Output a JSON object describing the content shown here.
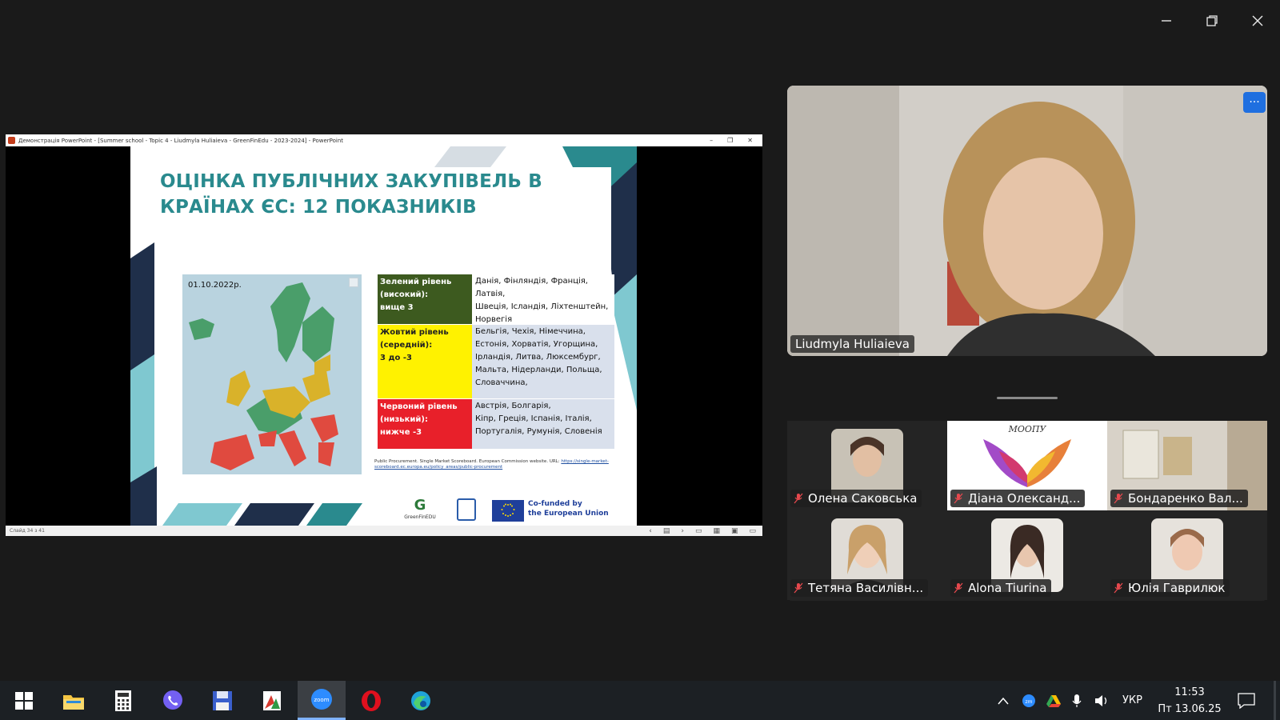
{
  "window": {
    "minimize": "minimize",
    "maximize": "restore",
    "close": "close"
  },
  "share": {
    "pp_title": "Демонстрація PowerPoint - [Summer school - Topic 4 - Liudmyla Huliaieva - GreenFinEdu - 2023-2024] - PowerPoint",
    "status": "Слайд 34 з 41",
    "slide": {
      "title": "ОЦІНКА ПУБЛІЧНИХ ЗАКУПІВЕЛЬ В КРАЇНАХ ЄС: 12 ПОКАЗНИКІВ",
      "map_date": "01.10.2022р.",
      "legend": {
        "green_level": "Зелений рівень\n(високий):\nвище 3",
        "green_countries": "Данія, Фінляндія, Франція,\nЛатвія,\nШвеція, Ісландія, Ліхтенштейн,\nНорвегія",
        "yellow_level": "Жовтий рівень\n(середній):\n3 до -3",
        "yellow_countries": "Бельгія, Чехія, Німеччина,\nЕстонія, Хорватія, Угорщина,\nІрландія, Литва, Люксембург,\nМальта, Нідерланди, Польща,\nСловаччина,",
        "red_level": "Червоний рівень\n(низький):\nнижче -3",
        "red_countries": "Австрія, Болгарія,\nКіпр, Греція, Іспанія, Італія,\nПортугалія, Румунія, Словенія"
      },
      "source_text": "Public Procurement. Single Market Scoreboard. European Commission website. URL: ",
      "source_link": "https://single-market-scoreboard.ec.europa.eu/policy_areas/public-procurement",
      "logo_gf": "GreenFinEDU",
      "eu_text": "Co-funded by\nthe European Union",
      "colors": {
        "title": "#2a8a8e",
        "green": "#3d5a1f",
        "yellow": "#fff200",
        "red": "#e8202a"
      }
    }
  },
  "speaker": {
    "name": "Liudmyla Huliaieva",
    "more": "···"
  },
  "participants": [
    {
      "name": "Олена Саковська",
      "muted": true
    },
    {
      "name": "Діана Олександ...",
      "muted": true,
      "banner": "МООПУ"
    },
    {
      "name": "Бондаренко Вал...",
      "muted": true
    },
    {
      "name": "Тетяна Василівн...",
      "muted": true
    },
    {
      "name": "Alona Tiurina",
      "muted": true
    },
    {
      "name": "Юлія Гаврилюк",
      "muted": true
    }
  ],
  "taskbar": {
    "apps": [
      "start-icon",
      "file-explorer-icon",
      "calculator-icon",
      "viber-icon",
      "save-icon",
      "pdf-icon",
      "zoom-icon",
      "opera-icon",
      "edge-icon"
    ],
    "active_label": "zoom",
    "lang": "УКР",
    "time": "11:53",
    "date": "Пт 13.06.25"
  }
}
